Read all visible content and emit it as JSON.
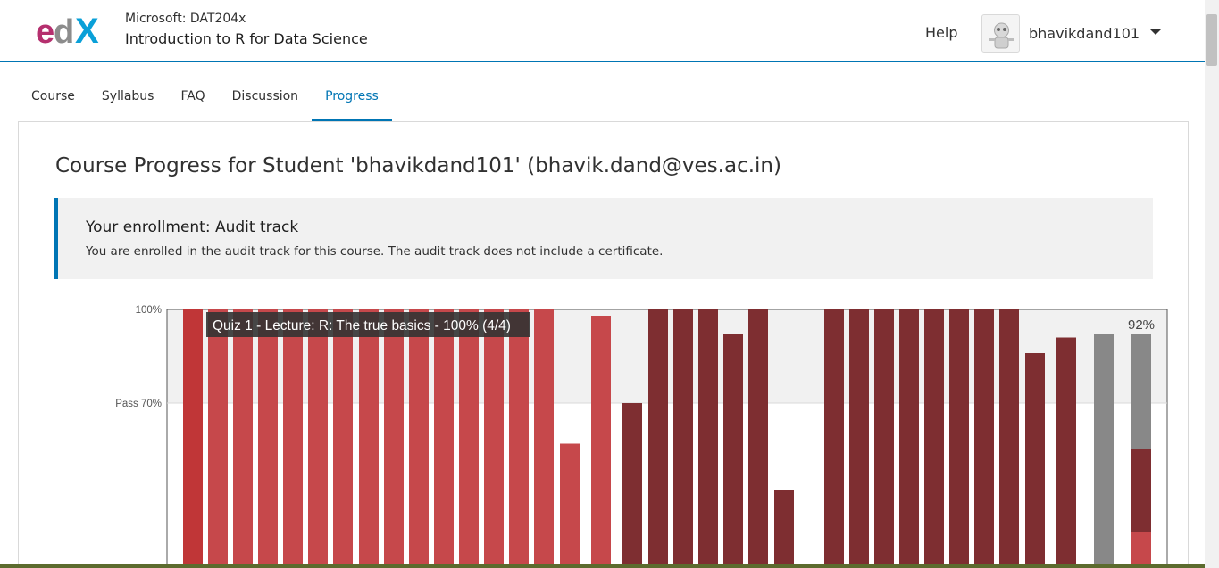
{
  "header": {
    "course_org": "Microsoft: DAT204x",
    "course_title": "Introduction to R for Data Science",
    "help_label": "Help",
    "username": "bhavikdand101",
    "logo_text": "edX"
  },
  "tabs": [
    {
      "label": "Course",
      "active": false
    },
    {
      "label": "Syllabus",
      "active": false
    },
    {
      "label": "FAQ",
      "active": false
    },
    {
      "label": "Discussion",
      "active": false
    },
    {
      "label": "Progress",
      "active": true
    }
  ],
  "main": {
    "heading": "Course Progress for Student 'bhavikdand101' (bhavik.dand@ves.ac.in)",
    "enrollment": {
      "title": "Your enrollment: Audit track",
      "text": "You are enrolled in the audit track for this course. The audit track does not include a certificate."
    }
  },
  "chart_data": {
    "type": "bar",
    "y_ticks": [
      {
        "label": "100%",
        "value": 100
      },
      {
        "label": "Pass 70%",
        "value": 70
      }
    ],
    "pass_threshold": 70,
    "tooltip": "Quiz 1 - Lecture: R: The true basics - 100% (4/4)",
    "total_label": "92%",
    "colors": {
      "quiz": "#c6484b",
      "quiz_first": "#c03637",
      "lab": "#7e2e31",
      "total": "#888888",
      "pass_band": "#f1f1f1"
    },
    "bars": [
      {
        "value": 100,
        "group": "quiz_first"
      },
      {
        "value": 100,
        "group": "quiz"
      },
      {
        "value": 100,
        "group": "quiz"
      },
      {
        "value": 100,
        "group": "quiz"
      },
      {
        "value": 100,
        "group": "quiz"
      },
      {
        "value": 100,
        "group": "quiz"
      },
      {
        "value": 100,
        "group": "quiz"
      },
      {
        "value": 100,
        "group": "quiz"
      },
      {
        "value": 100,
        "group": "quiz"
      },
      {
        "value": 100,
        "group": "quiz"
      },
      {
        "value": 100,
        "group": "quiz"
      },
      {
        "value": 100,
        "group": "quiz"
      },
      {
        "value": 100,
        "group": "quiz"
      },
      {
        "value": 100,
        "group": "quiz"
      },
      {
        "value": 100,
        "group": "quiz"
      },
      {
        "value": 57,
        "group": "quiz"
      },
      {
        "value": 98,
        "group": "quiz"
      },
      {
        "value": 70,
        "group": "lab"
      },
      {
        "value": 100,
        "group": "lab"
      },
      {
        "value": 100,
        "group": "lab"
      },
      {
        "value": 100,
        "group": "lab"
      },
      {
        "value": 92,
        "group": "lab"
      },
      {
        "value": 100,
        "group": "lab"
      },
      {
        "value": 42,
        "group": "lab"
      },
      {
        "value": 0,
        "group": "lab"
      },
      {
        "value": 0,
        "group": "lab"
      },
      {
        "value": 100,
        "group": "lab"
      },
      {
        "value": 100,
        "group": "lab"
      },
      {
        "value": 100,
        "group": "lab"
      },
      {
        "value": 100,
        "group": "lab"
      },
      {
        "value": 100,
        "group": "lab"
      },
      {
        "value": 100,
        "group": "lab"
      },
      {
        "value": 100,
        "group": "lab"
      },
      {
        "value": 100,
        "group": "lab"
      },
      {
        "value": 86,
        "group": "lab"
      },
      {
        "value": 0,
        "group": "lab"
      },
      {
        "value": 91,
        "group": "lab"
      },
      {
        "value": 92,
        "group": "total"
      },
      {
        "value": 92,
        "group": "total"
      }
    ]
  }
}
